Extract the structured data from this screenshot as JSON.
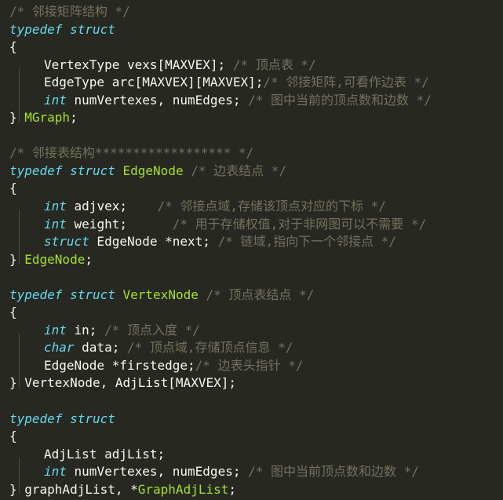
{
  "theme": {
    "background": "#272822",
    "text": "#f8f8f2",
    "keyword": "#66d9ef",
    "type_name": "#a6e22e",
    "comment": "#75715e"
  },
  "lines": [
    {
      "indent": false,
      "tokens": [
        {
          "t": "cm",
          "v": "/* 邻接矩阵结构 */"
        }
      ]
    },
    {
      "indent": false,
      "tokens": [
        {
          "t": "kw",
          "v": "typedef"
        },
        {
          "t": "pl",
          "v": " "
        },
        {
          "t": "kw",
          "v": "struct"
        }
      ]
    },
    {
      "indent": false,
      "tokens": [
        {
          "t": "pl",
          "v": "{"
        }
      ]
    },
    {
      "indent": true,
      "tokens": [
        {
          "t": "pl",
          "v": "VertexType vexs[MAXVEX]; "
        },
        {
          "t": "cm",
          "v": "/* 顶点表 */"
        }
      ]
    },
    {
      "indent": true,
      "tokens": [
        {
          "t": "pl",
          "v": "EdgeType arc[MAXVEX][MAXVEX];"
        },
        {
          "t": "cm",
          "v": "/* 邻接矩阵,可看作边表 */"
        }
      ]
    },
    {
      "indent": true,
      "tokens": [
        {
          "t": "kw",
          "v": "int"
        },
        {
          "t": "pl",
          "v": " numVertexes, numEdges; "
        },
        {
          "t": "cm",
          "v": "/* 图中当前的顶点数和边数 */"
        }
      ]
    },
    {
      "indent": false,
      "tokens": [
        {
          "t": "pl",
          "v": "} "
        },
        {
          "t": "ty",
          "v": "MGraph"
        },
        {
          "t": "pl",
          "v": ";"
        }
      ]
    },
    {
      "indent": false,
      "tokens": []
    },
    {
      "indent": false,
      "tokens": [
        {
          "t": "cm",
          "v": "/* 邻接表结构****************** */"
        }
      ]
    },
    {
      "indent": false,
      "tokens": [
        {
          "t": "kw",
          "v": "typedef"
        },
        {
          "t": "pl",
          "v": " "
        },
        {
          "t": "kw",
          "v": "struct"
        },
        {
          "t": "pl",
          "v": " "
        },
        {
          "t": "ty",
          "v": "EdgeNode"
        },
        {
          "t": "pl",
          "v": " "
        },
        {
          "t": "cm",
          "v": "/* 边表结点 */"
        }
      ]
    },
    {
      "indent": false,
      "tokens": [
        {
          "t": "pl",
          "v": "{"
        }
      ]
    },
    {
      "indent": true,
      "tokens": [
        {
          "t": "kw",
          "v": "int"
        },
        {
          "t": "pl",
          "v": " adjvex;    "
        },
        {
          "t": "cm",
          "v": "/* 邻接点域,存储该顶点对应的下标 */"
        }
      ]
    },
    {
      "indent": true,
      "tokens": [
        {
          "t": "kw",
          "v": "int"
        },
        {
          "t": "pl",
          "v": " weight;      "
        },
        {
          "t": "cm",
          "v": "/* 用于存储权值,对于非网图可以不需要 */"
        }
      ]
    },
    {
      "indent": true,
      "tokens": [
        {
          "t": "kw",
          "v": "struct"
        },
        {
          "t": "pl",
          "v": " EdgeNode *next; "
        },
        {
          "t": "cm",
          "v": "/* 链域,指向下一个邻接点 */"
        }
      ]
    },
    {
      "indent": false,
      "tokens": [
        {
          "t": "pl",
          "v": "} "
        },
        {
          "t": "ty",
          "v": "EdgeNode"
        },
        {
          "t": "pl",
          "v": ";"
        }
      ]
    },
    {
      "indent": false,
      "tokens": []
    },
    {
      "indent": false,
      "tokens": [
        {
          "t": "kw",
          "v": "typedef"
        },
        {
          "t": "pl",
          "v": " "
        },
        {
          "t": "kw",
          "v": "struct"
        },
        {
          "t": "pl",
          "v": " "
        },
        {
          "t": "ty",
          "v": "VertexNode"
        },
        {
          "t": "pl",
          "v": " "
        },
        {
          "t": "cm",
          "v": "/* 顶点表结点 */"
        }
      ]
    },
    {
      "indent": false,
      "tokens": [
        {
          "t": "pl",
          "v": "{"
        }
      ]
    },
    {
      "indent": true,
      "tokens": [
        {
          "t": "kw",
          "v": "int"
        },
        {
          "t": "pl",
          "v": " in; "
        },
        {
          "t": "cm",
          "v": "/* 顶点入度 */"
        }
      ]
    },
    {
      "indent": true,
      "tokens": [
        {
          "t": "kw",
          "v": "char"
        },
        {
          "t": "pl",
          "v": " data; "
        },
        {
          "t": "cm",
          "v": "/* 顶点域,存储顶点信息 */"
        }
      ]
    },
    {
      "indent": true,
      "tokens": [
        {
          "t": "pl",
          "v": "EdgeNode *firstedge;"
        },
        {
          "t": "cm",
          "v": "/* 边表头指针 */"
        }
      ]
    },
    {
      "indent": false,
      "tokens": [
        {
          "t": "pl",
          "v": "} VertexNode, AdjList[MAXVEX];"
        }
      ]
    },
    {
      "indent": false,
      "tokens": []
    },
    {
      "indent": false,
      "tokens": [
        {
          "t": "kw",
          "v": "typedef"
        },
        {
          "t": "pl",
          "v": " "
        },
        {
          "t": "kw",
          "v": "struct"
        }
      ]
    },
    {
      "indent": false,
      "tokens": [
        {
          "t": "pl",
          "v": "{"
        }
      ]
    },
    {
      "indent": true,
      "tokens": [
        {
          "t": "pl",
          "v": "AdjList adjList;"
        }
      ]
    },
    {
      "indent": true,
      "tokens": [
        {
          "t": "kw",
          "v": "int"
        },
        {
          "t": "pl",
          "v": " numVertexes, numEdges; "
        },
        {
          "t": "cm",
          "v": "/* 图中当前顶点数和边数 */"
        }
      ]
    },
    {
      "indent": false,
      "tokens": [
        {
          "t": "pl",
          "v": "} graphAdjList, *"
        },
        {
          "t": "ty",
          "v": "GraphAdjList"
        },
        {
          "t": "pl",
          "v": ";"
        }
      ]
    }
  ]
}
